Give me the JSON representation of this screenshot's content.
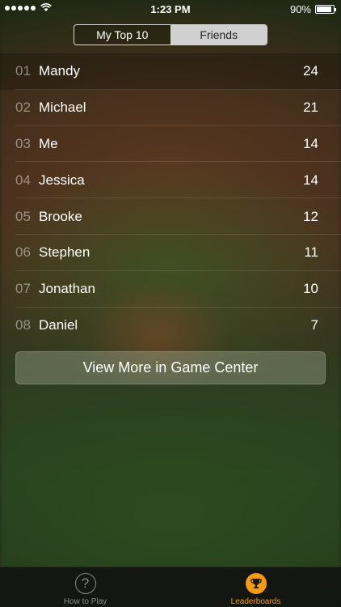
{
  "status_bar": {
    "time": "1:23 PM",
    "battery": "90%",
    "battery_level": 0.9,
    "signal_bars": 5,
    "icons": [
      "signal-dots-icon",
      "wifi-icon",
      "battery-icon"
    ]
  },
  "segments": [
    {
      "label": "My Top 10",
      "selected": false
    },
    {
      "label": "Friends",
      "selected": true
    }
  ],
  "leaderboard": [
    {
      "rank": "01",
      "name": "Mandy",
      "score": "24"
    },
    {
      "rank": "02",
      "name": "Michael",
      "score": "21"
    },
    {
      "rank": "03",
      "name": "Me",
      "score": "14"
    },
    {
      "rank": "04",
      "name": "Jessica",
      "score": "14"
    },
    {
      "rank": "05",
      "name": "Brooke",
      "score": "12"
    },
    {
      "rank": "06",
      "name": "Stephen",
      "score": "11"
    },
    {
      "rank": "07",
      "name": "Jonathan",
      "score": "10"
    },
    {
      "rank": "08",
      "name": "Daniel",
      "score": "7"
    }
  ],
  "game_center_button": "View More in Game Center",
  "tabs": [
    {
      "label": "How to Play",
      "icon": "question-icon",
      "active": false
    },
    {
      "label": "Leaderboards",
      "icon": "trophy-icon",
      "active": true
    }
  ],
  "colors": {
    "accent": "#f39c12",
    "inactive": "#8a8a8a"
  }
}
